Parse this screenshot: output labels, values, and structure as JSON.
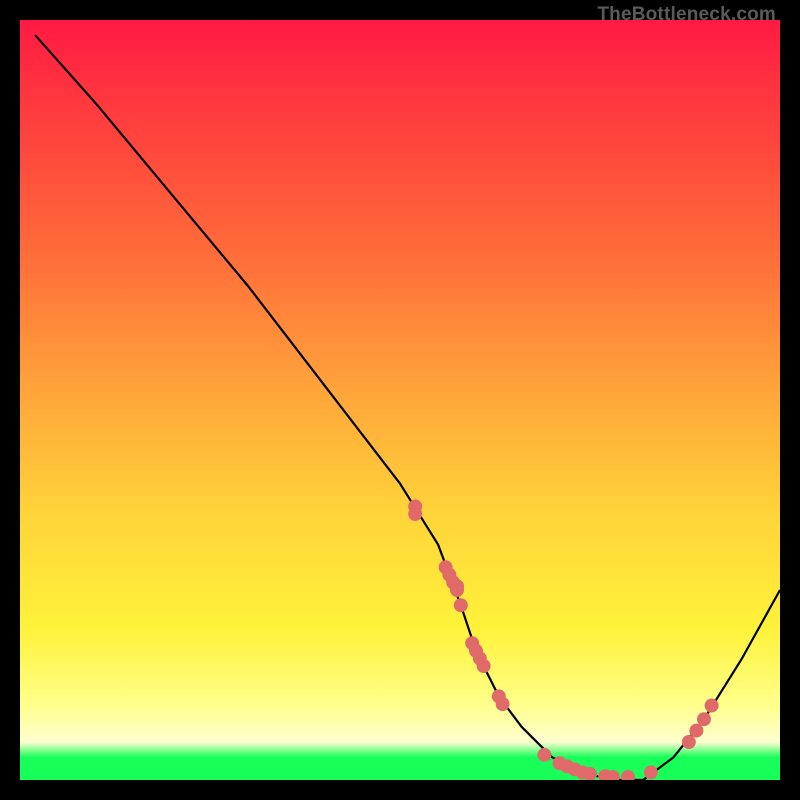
{
  "credit": "TheBottleneck.com",
  "chart_data": {
    "type": "line",
    "title": "",
    "xlabel": "",
    "ylabel": "",
    "xlim": [
      0,
      100
    ],
    "ylim": [
      0,
      100
    ],
    "grid": false,
    "legend": false,
    "gradient_colors": {
      "top": "#ff1a44",
      "mid_upper": "#ff6a3a",
      "mid": "#ffd43a",
      "mid_lower": "#ffff8a",
      "bottom_strip": "#19ff5a"
    },
    "series": [
      {
        "name": "curve",
        "color": "#000000",
        "x": [
          2,
          10,
          20,
          30,
          40,
          50,
          55,
          58,
          60,
          63,
          66,
          70,
          74,
          78,
          82,
          86,
          90,
          95,
          100
        ],
        "y": [
          98,
          89,
          77,
          65,
          52,
          39,
          31,
          23,
          17,
          11,
          7,
          3,
          1,
          0,
          0,
          3,
          8,
          16,
          25
        ]
      }
    ],
    "scatter": {
      "name": "markers",
      "color": "#e06a6a",
      "radius": 7,
      "points": [
        {
          "x": 52,
          "y": 36
        },
        {
          "x": 52,
          "y": 35
        },
        {
          "x": 56,
          "y": 28
        },
        {
          "x": 56.5,
          "y": 27
        },
        {
          "x": 57,
          "y": 26
        },
        {
          "x": 57.5,
          "y": 25.5
        },
        {
          "x": 57.5,
          "y": 25
        },
        {
          "x": 58,
          "y": 23
        },
        {
          "x": 59.5,
          "y": 18
        },
        {
          "x": 60,
          "y": 17
        },
        {
          "x": 60.5,
          "y": 16
        },
        {
          "x": 61,
          "y": 15
        },
        {
          "x": 63,
          "y": 11
        },
        {
          "x": 63.5,
          "y": 10
        },
        {
          "x": 69,
          "y": 3.3
        },
        {
          "x": 71,
          "y": 2.2
        },
        {
          "x": 72,
          "y": 1.8
        },
        {
          "x": 73,
          "y": 1.4
        },
        {
          "x": 74,
          "y": 1.0
        },
        {
          "x": 75,
          "y": 0.8
        },
        {
          "x": 77,
          "y": 0.5
        },
        {
          "x": 78,
          "y": 0.4
        },
        {
          "x": 80,
          "y": 0.4
        },
        {
          "x": 83,
          "y": 1.0
        },
        {
          "x": 88,
          "y": 5
        },
        {
          "x": 89,
          "y": 6.5
        },
        {
          "x": 90,
          "y": 8
        },
        {
          "x": 91,
          "y": 9.8
        }
      ]
    }
  }
}
